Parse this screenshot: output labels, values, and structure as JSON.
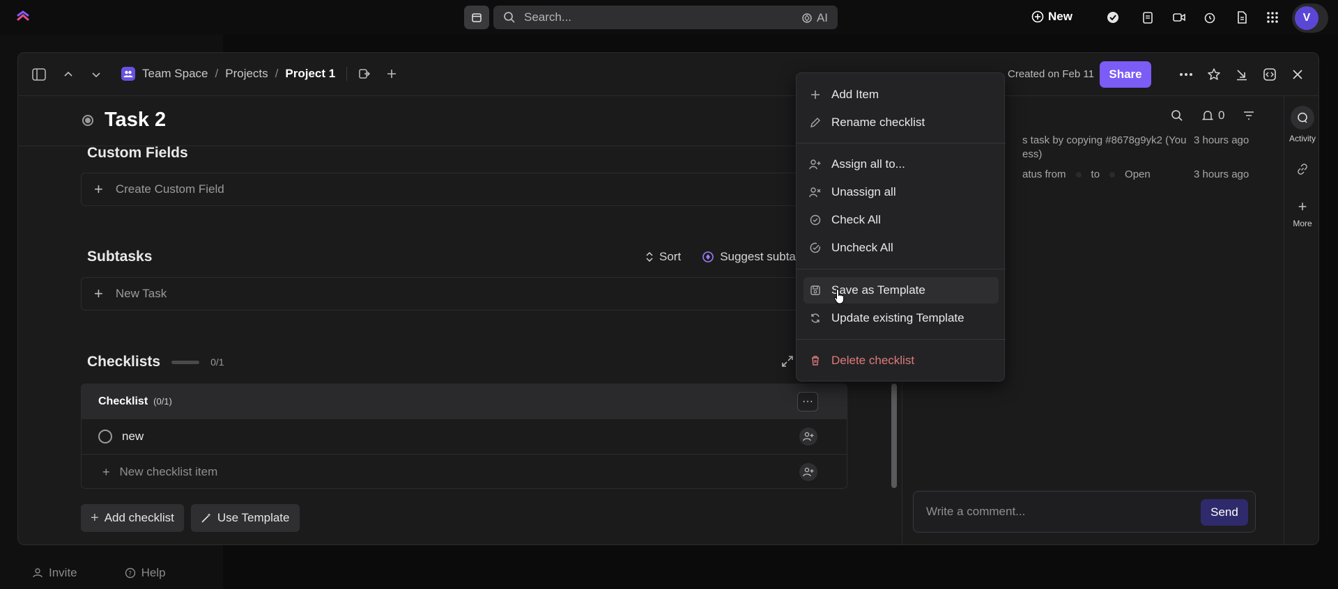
{
  "topbar": {
    "search_placeholder": "Search...",
    "ai_label": "AI",
    "new_label": "New",
    "avatar_initial": "V"
  },
  "background": {
    "invite_label": "Invite",
    "help_label": "Help"
  },
  "modal": {
    "breadcrumb": {
      "space": "Team Space",
      "folder": "Projects",
      "list": "Project 1",
      "sep": "/"
    },
    "created_text": "Created on Feb 11",
    "share_label": "Share"
  },
  "task": {
    "title": "Task 2",
    "custom_fields_title": "Custom Fields",
    "create_custom_field": "Create Custom Field",
    "subtasks_title": "Subtasks",
    "sort_label": "Sort",
    "suggest_label": "Suggest subta",
    "new_task": "New Task",
    "checklists_title": "Checklists",
    "checklists_count": "0/1",
    "checklist": {
      "name": "Checklist",
      "count": "(0/1)",
      "menu": "···",
      "items": [
        {
          "label": "new"
        }
      ],
      "new_item_placeholder": "New checklist item"
    },
    "add_checklist": "Add checklist",
    "use_template": "Use Template"
  },
  "activity": {
    "notif_count": "0",
    "entries": [
      {
        "text_line1": "s task by copying #8678g9yk2 (You",
        "text_line2": "ess)",
        "time": "3 hours ago"
      },
      {
        "text_a": "atus from",
        "text_b": "to",
        "text_c": "Open",
        "time": "3 hours ago"
      }
    ],
    "comment_placeholder": "Write a comment...",
    "send_label": "Send"
  },
  "rail": {
    "activity_label": "Activity",
    "more_label": "More"
  },
  "dropdown": {
    "items": [
      {
        "label": "Add Item",
        "icon": "plus-icon"
      },
      {
        "label": "Rename checklist",
        "icon": "pencil-icon"
      },
      {
        "label": "Assign all to...",
        "icon": "assign-user-icon"
      },
      {
        "label": "Unassign all",
        "icon": "unassign-user-icon"
      },
      {
        "label": "Check All",
        "icon": "check-circle-icon"
      },
      {
        "label": "Uncheck All",
        "icon": "uncheck-circle-icon"
      },
      {
        "label": "Save as Template",
        "icon": "template-save-icon"
      },
      {
        "label": "Update existing Template",
        "icon": "refresh-icon"
      },
      {
        "label": "Delete checklist",
        "icon": "trash-icon"
      }
    ]
  },
  "colors": {
    "accent": "#7b5cf5",
    "danger": "#e07a7a",
    "background": "#1b1b1c"
  }
}
